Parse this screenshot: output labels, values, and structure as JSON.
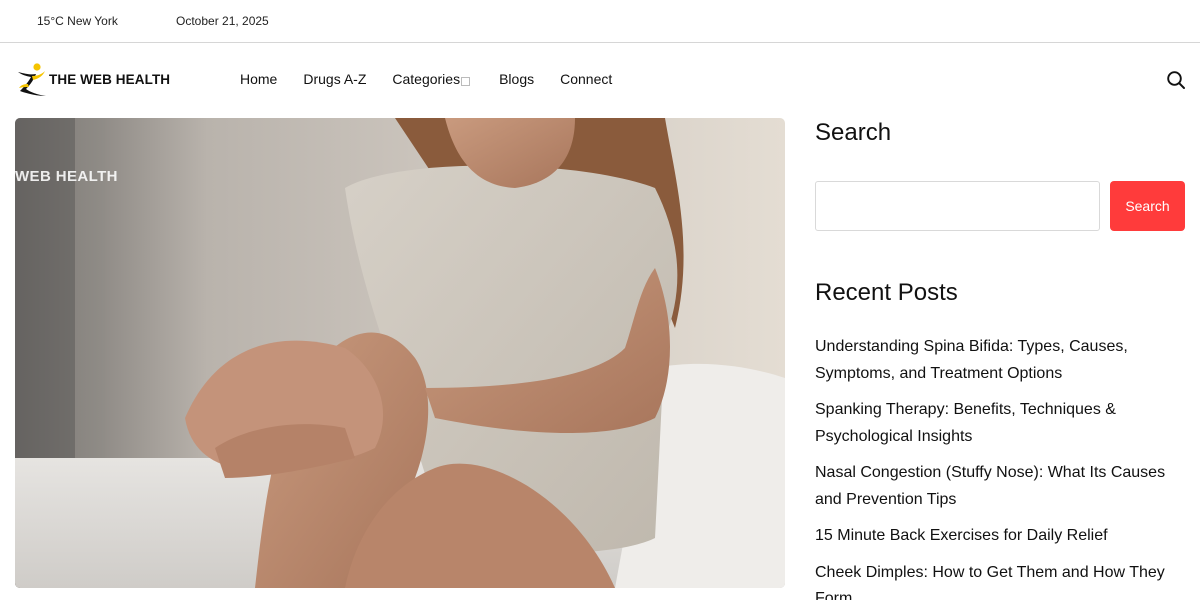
{
  "topbar": {
    "weather": "15°C New York",
    "date": "October 21, 2025"
  },
  "header": {
    "logo_text": "THE WEB HEALTH",
    "nav": [
      {
        "label": "Home"
      },
      {
        "label": "Drugs A-Z"
      },
      {
        "label": "Categories"
      },
      {
        "label": "Blogs"
      },
      {
        "label": "Connect"
      }
    ],
    "search_icon": "search-icon"
  },
  "hero": {
    "watermark": "WEB HEALTH"
  },
  "sidebar": {
    "search": {
      "title": "Search",
      "input_value": "",
      "button_label": "Search"
    },
    "recent": {
      "title": "Recent Posts",
      "posts": [
        {
          "title": "Understanding Spina Bifida: Types, Causes, Symptoms, and Treatment Options"
        },
        {
          "title": "Spanking Therapy: Benefits, Techniques & Psychological Insights"
        },
        {
          "title": "Nasal Congestion (Stuffy Nose): What Its Causes and Prevention Tips"
        },
        {
          "title": "15 Minute Back Exercises for Daily Relief"
        },
        {
          "title": "Cheek Dimples: How to Get Them and How They Form"
        }
      ]
    }
  },
  "colors": {
    "accent": "#ff3b3b",
    "text": "#111111",
    "border": "#d9d9d9",
    "logo_yellow": "#f5c400"
  }
}
